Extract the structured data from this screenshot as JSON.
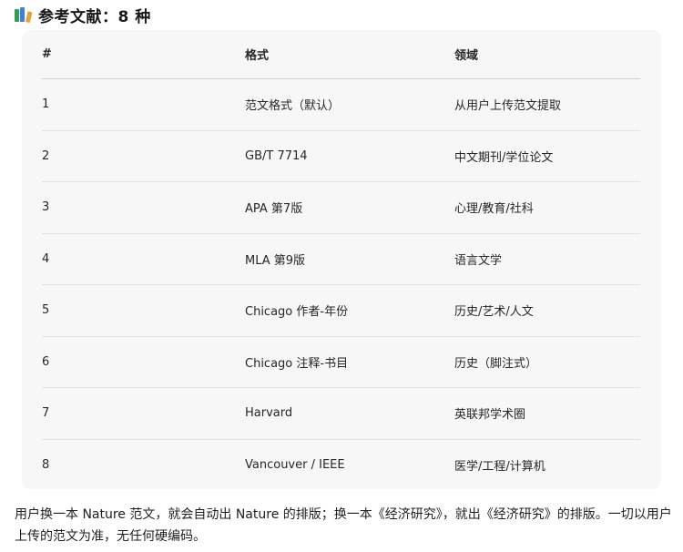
{
  "heading": {
    "icon": "books-icon",
    "title": "参考文献：8 种"
  },
  "table": {
    "columns": [
      "#",
      "格式",
      "领域"
    ],
    "rows": [
      [
        "1",
        "范文格式（默认）",
        "从用户上传范文提取"
      ],
      [
        "2",
        "GB/T 7714",
        "中文期刊/学位论文"
      ],
      [
        "3",
        "APA 第7版",
        "心理/教育/社科"
      ],
      [
        "4",
        "MLA 第9版",
        "语言文学"
      ],
      [
        "5",
        "Chicago 作者-年份",
        "历史/艺术/人文"
      ],
      [
        "6",
        "Chicago 注释-书目",
        "历史（脚注式）"
      ],
      [
        "7",
        "Harvard",
        "英联邦学术圈"
      ],
      [
        "8",
        "Vancouver / IEEE",
        "医学/工程/计算机"
      ]
    ]
  },
  "footer": {
    "text": "用户换一本 Nature 范文，就会自动出 Nature 的排版；换一本《经济研究》，就出《经济研究》的排版。一切以用户上传的范文为准，无任何硬编码。"
  }
}
